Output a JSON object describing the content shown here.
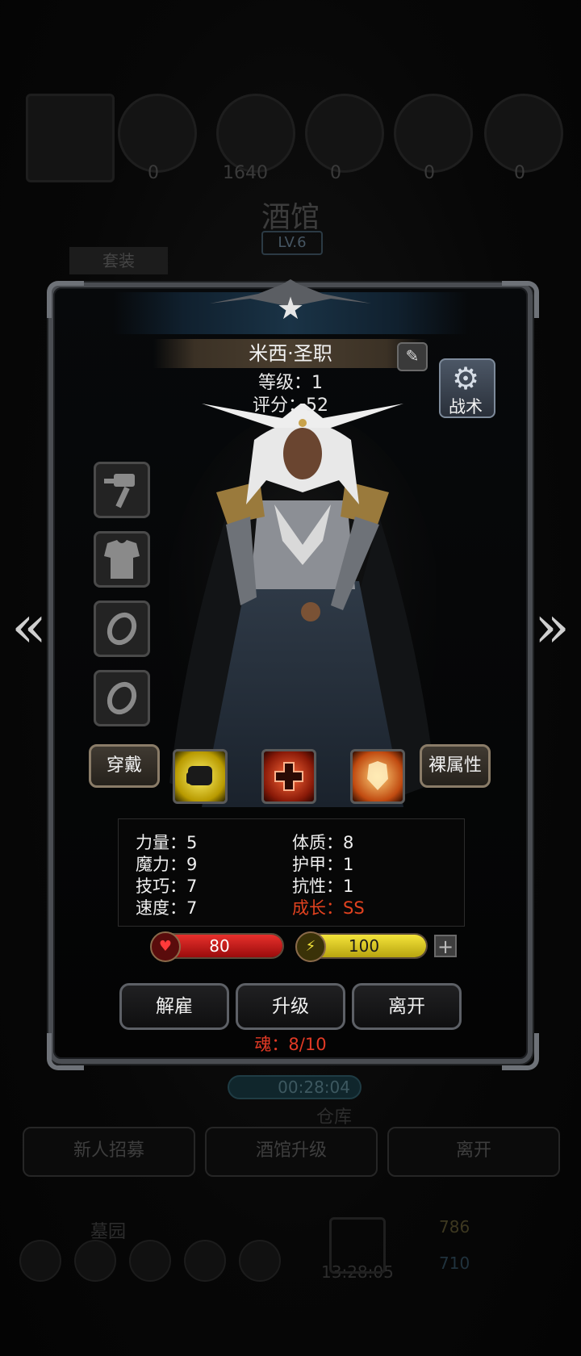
{
  "background": {
    "resources": [
      "0",
      "1640",
      "0",
      "0",
      "0"
    ],
    "tavern_title": "酒馆",
    "tavern_level": "LV.6",
    "set_tab": "套装",
    "timer": "00:28:04",
    "warehouse": "仓库",
    "buttons": [
      "新人招募",
      "酒馆升级",
      "离开"
    ],
    "bottom_label": "墓园",
    "bottom_timer": "13:28:05",
    "gold": "786",
    "gems": "710"
  },
  "hero": {
    "name": "米西·圣职",
    "level": "等级：1",
    "score": "评分：52"
  },
  "tactics_label": "战术",
  "equip_slots": [
    "hammer-icon",
    "armor-icon",
    "ring-icon",
    "ring-icon"
  ],
  "actions": {
    "wear": "穿戴",
    "bare_attr": "裸属性"
  },
  "stats": {
    "left": [
      "力量：5",
      "魔力：9",
      "技巧：7",
      "速度：7"
    ],
    "right": [
      "体质：8",
      "护甲：1",
      "抗性：1"
    ],
    "growth": "成长：SS"
  },
  "hp": {
    "value": "80",
    "fill": 1.0
  },
  "energy": {
    "value": "100",
    "fill": 1.0
  },
  "buttons": {
    "dismiss": "解雇",
    "upgrade": "升级",
    "leave": "离开"
  },
  "soul": "魂：8/10",
  "colors": {
    "hp": "#c8161a",
    "energy": "#d8c81a",
    "growth": "#e2421f",
    "soul": "#e23a25"
  }
}
